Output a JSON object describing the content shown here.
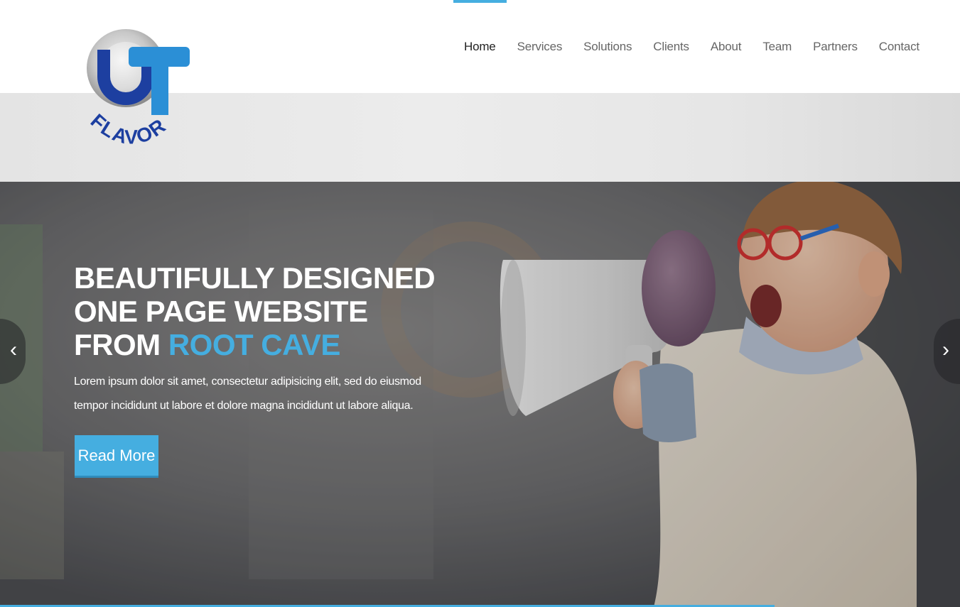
{
  "brand": {
    "logo_text": "UT",
    "logo_tagline": "FLAVOR",
    "colors": {
      "accent": "#45aee0",
      "logo_blue": "#1d3fa0",
      "logo_light_blue": "#2b8fd6"
    }
  },
  "nav": {
    "items": [
      {
        "label": "Home",
        "active": true
      },
      {
        "label": "Services"
      },
      {
        "label": "Solutions"
      },
      {
        "label": "Clients"
      },
      {
        "label": "About"
      },
      {
        "label": "Team"
      },
      {
        "label": "Partners"
      },
      {
        "label": "Contact"
      }
    ]
  },
  "hero": {
    "title_part1": "BEAUTIFULLY DESIGNED ONE PAGE WEBSITE FROM ",
    "title_accent": "ROOT CAVE",
    "text": "Lorem ipsum dolor sit amet, consectetur adipisicing elit, sed do eiusmod tempor incididunt ut labore et dolore magna incididunt ut labore aliqua.",
    "button_label": "Read More",
    "prev_icon": "‹",
    "next_icon": "›"
  }
}
